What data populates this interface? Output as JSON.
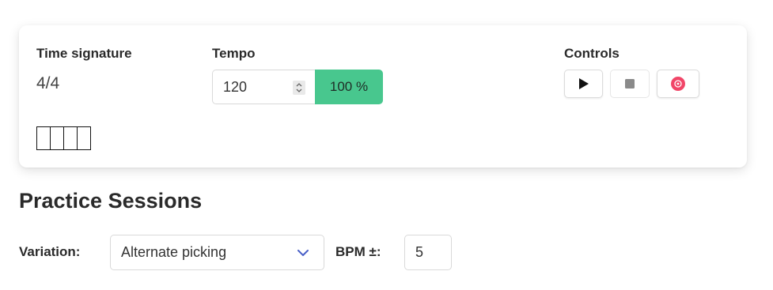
{
  "metronome": {
    "time_signature_label": "Time signature",
    "time_signature_value": "4/4",
    "beats": 4,
    "tempo_label": "Tempo",
    "tempo_value": "120",
    "tempo_percent": "100 %",
    "controls_label": "Controls",
    "buttons": {
      "play_icon": "play-icon",
      "stop_icon": "stop-icon",
      "record_icon": "record-icon"
    },
    "colors": {
      "percent_bg": "#48c78e",
      "record": "#f14668",
      "stop": "#8a8a8a"
    }
  },
  "practice": {
    "title": "Practice Sessions",
    "variation_label": "Variation:",
    "variation_value": "Alternate picking",
    "bpm_label": "BPM ±:",
    "bpm_value": "5",
    "colors": {
      "chevron": "#485fc7"
    }
  }
}
